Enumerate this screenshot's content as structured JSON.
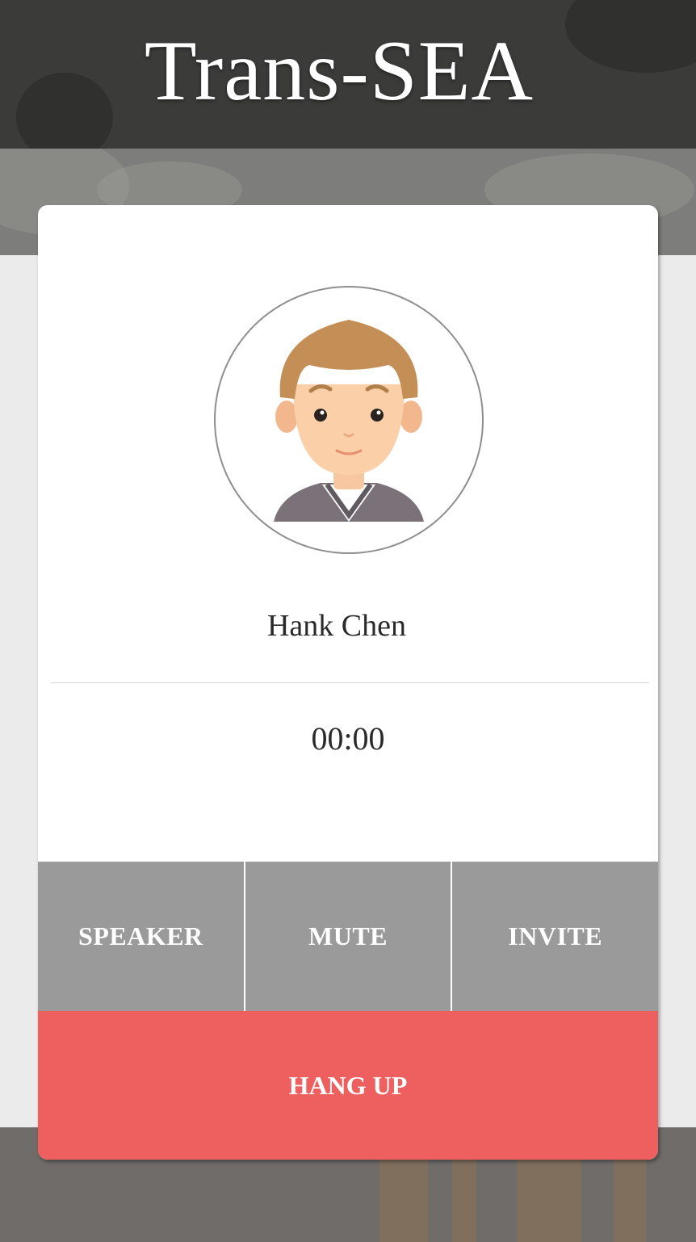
{
  "app": {
    "title": "Trans-SEA"
  },
  "call": {
    "caller_name": "Hank Chen",
    "duration": "00:00",
    "avatar_icon": "male-avatar-icon"
  },
  "controls": {
    "speaker_label": "SPEAKER",
    "mute_label": "MUTE",
    "invite_label": "INVITE",
    "hangup_label": "HANG UP"
  },
  "colors": {
    "header": "#3b3b3a",
    "control_button": "#9a9a9a",
    "hangup_button": "#ee5f5f",
    "card": "#ffffff"
  }
}
